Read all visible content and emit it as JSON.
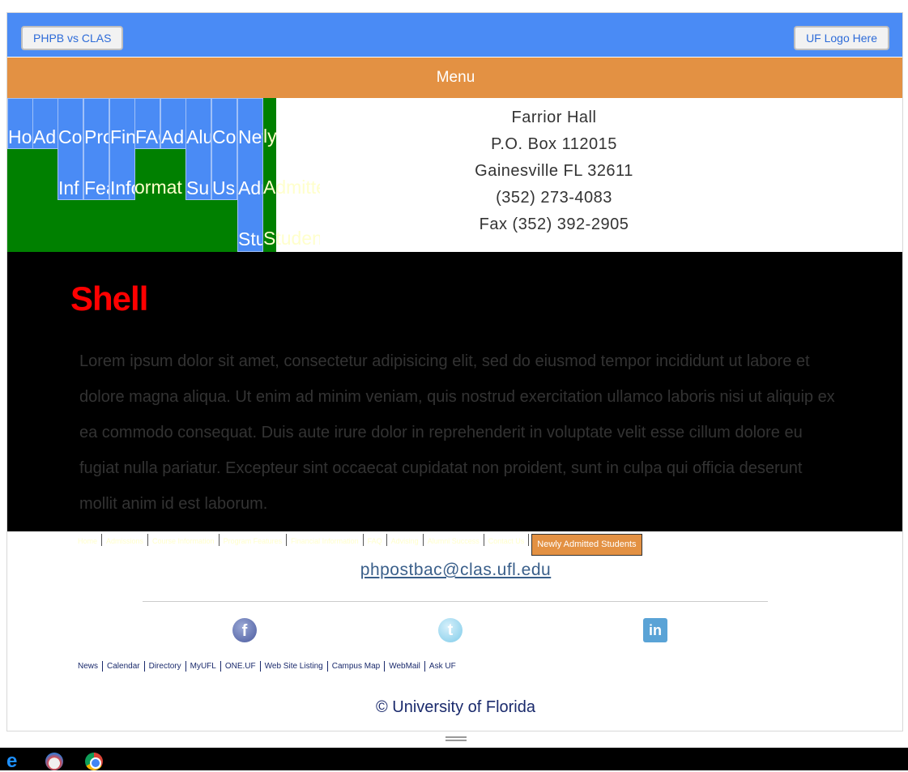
{
  "header": {
    "left_button": "PHPB vs CLAS",
    "right_button": "UF Logo Here",
    "menu_label": "Menu"
  },
  "nav": {
    "items": [
      "Ho",
      "Ad",
      "Co",
      "Pro",
      "Fin",
      "FAQ",
      "Ad",
      "Alu",
      "Co",
      "New",
      "ly"
    ],
    "second_row": [
      "Inf",
      "Fea",
      "Infor",
      "ormat",
      "Su",
      "Us",
      "Admitted"
    ],
    "third_row": [
      "Students"
    ]
  },
  "address": {
    "line1": "Farrior Hall",
    "line2": "P.O. Box 112015",
    "line3": "Gainesville FL 32611",
    "line4": "(352) 273-4083",
    "line5": "Fax (352) 392-2905"
  },
  "hero": {
    "title": "Shell",
    "body": "Lorem ipsum dolor sit amet, consectetur adipisicing elit, sed do eiusmod tempor incididunt ut labore et dolore magna aliqua. Ut enim ad minim veniam, quis nostrud exercitation ullamco laboris nisi ut aliquip ex ea commodo consequat. Duis aute irure dolor in reprehenderit in voluptate velit esse cillum dolore eu fugiat nulla pariatur. Excepteur sint occaecat cupidatat non proident, sunt in culpa qui officia deserunt mollit anim id est laborum."
  },
  "footer_nav": {
    "items": [
      "Home",
      "Admissions",
      "Course Information",
      "Program Features",
      "Financial Information",
      "FAQ",
      "Advising",
      "Alumni Success",
      "Contact Us"
    ],
    "active": "Newly Admitted Students"
  },
  "contact": {
    "email": "phpostbac@clas.ufl.edu"
  },
  "social": {
    "facebook": "facebook-icon",
    "twitter": "twitter-icon",
    "linkedin": "linkedin-icon"
  },
  "uf_links": [
    "News",
    "Calendar",
    "Directory",
    "MyUFL",
    "ONE.UF",
    "Web Site Listing",
    "Campus Map",
    "WebMail",
    "Ask UF"
  ],
  "copyright": "© University of Florida",
  "colors": {
    "header_blue": "#4a8bf5",
    "menu_orange": "#e39143",
    "nav_green": "#008000",
    "hero_title_red": "#ff0000"
  }
}
